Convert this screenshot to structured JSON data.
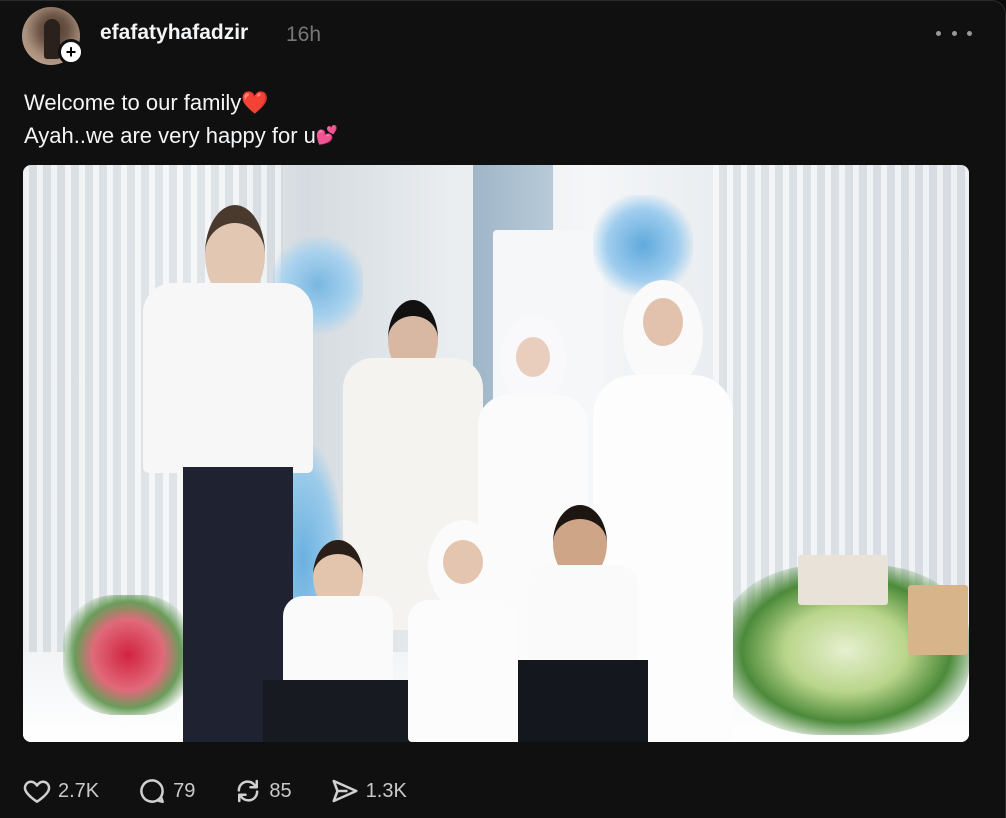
{
  "post": {
    "username": "efafatyhafadzir",
    "timestamp": "16h",
    "caption_line1": "Welcome to our family",
    "caption_line1_emoji": "❤️",
    "caption_line2": "Ayah..we are very happy for u",
    "caption_line2_emoji": "💕",
    "image_alt": "Family wedding photo"
  },
  "icons": {
    "follow": "plus-icon",
    "more": "more-icon",
    "like": "heart-icon",
    "reply": "comment-icon",
    "repost": "repost-icon",
    "share": "send-icon"
  },
  "actions": {
    "like_count": "2.7K",
    "reply_count": "79",
    "repost_count": "85",
    "share_count": "1.3K"
  },
  "colors": {
    "background": "#101010",
    "text": "#f3f5f7",
    "muted": "#777777"
  }
}
